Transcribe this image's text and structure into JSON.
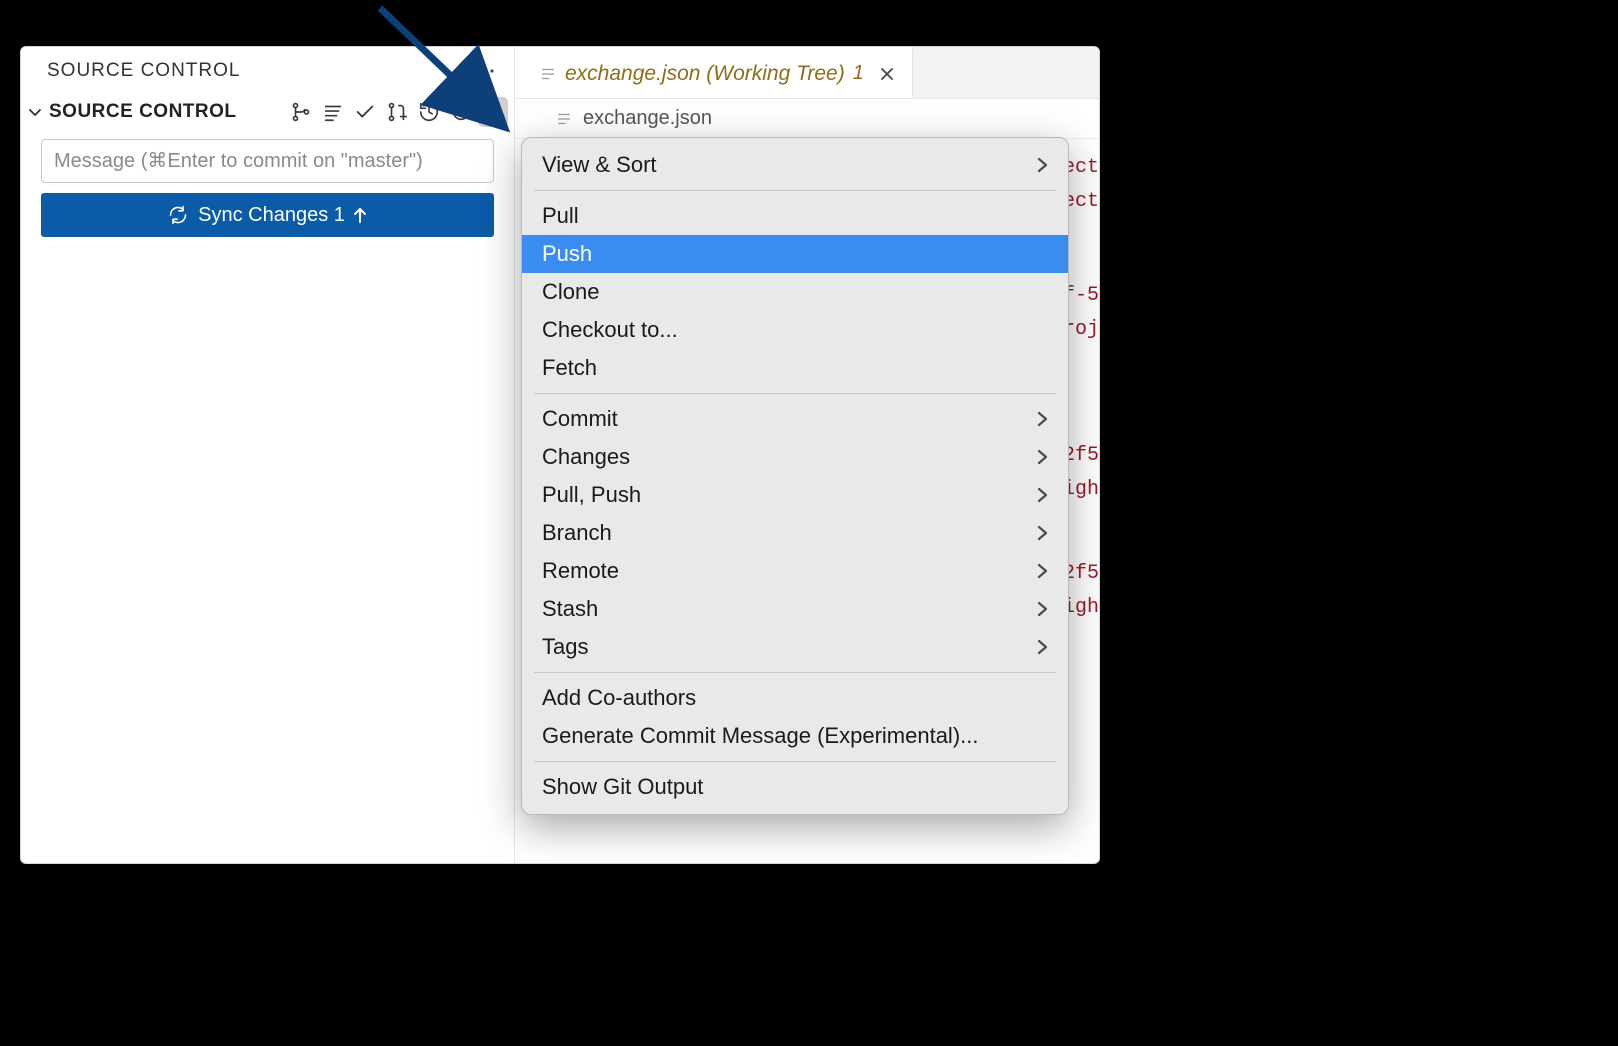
{
  "sidebar": {
    "title": "SOURCE CONTROL",
    "section_title": "SOURCE CONTROL",
    "commit_placeholder": "Message (⌘Enter to commit on \"master\")",
    "sync_label": "Sync Changes 1"
  },
  "tab": {
    "label": "exchange.json (Working Tree)",
    "badge": "1"
  },
  "breadcrumb": {
    "file": "exchange.json"
  },
  "code_fragments": {
    "l1": "ect",
    "l2": "ect",
    "l3": "f-5",
    "l4": "roj",
    "l5": "2f5",
    "l6": "igh",
    "l7": "2f5",
    "l8": "igh"
  },
  "menu": {
    "group1": [
      {
        "label": "View & Sort",
        "submenu": true
      }
    ],
    "group2": [
      {
        "label": "Pull",
        "submenu": false
      },
      {
        "label": "Push",
        "submenu": false,
        "highlighted": true
      },
      {
        "label": "Clone",
        "submenu": false
      },
      {
        "label": "Checkout to...",
        "submenu": false
      },
      {
        "label": "Fetch",
        "submenu": false
      }
    ],
    "group3": [
      {
        "label": "Commit",
        "submenu": true
      },
      {
        "label": "Changes",
        "submenu": true
      },
      {
        "label": "Pull, Push",
        "submenu": true
      },
      {
        "label": "Branch",
        "submenu": true
      },
      {
        "label": "Remote",
        "submenu": true
      },
      {
        "label": "Stash",
        "submenu": true
      },
      {
        "label": "Tags",
        "submenu": true
      }
    ],
    "group4": [
      {
        "label": "Add Co-authors",
        "submenu": false
      },
      {
        "label": "Generate Commit Message (Experimental)...",
        "submenu": false
      }
    ],
    "group5": [
      {
        "label": "Show Git Output",
        "submenu": false
      }
    ]
  }
}
